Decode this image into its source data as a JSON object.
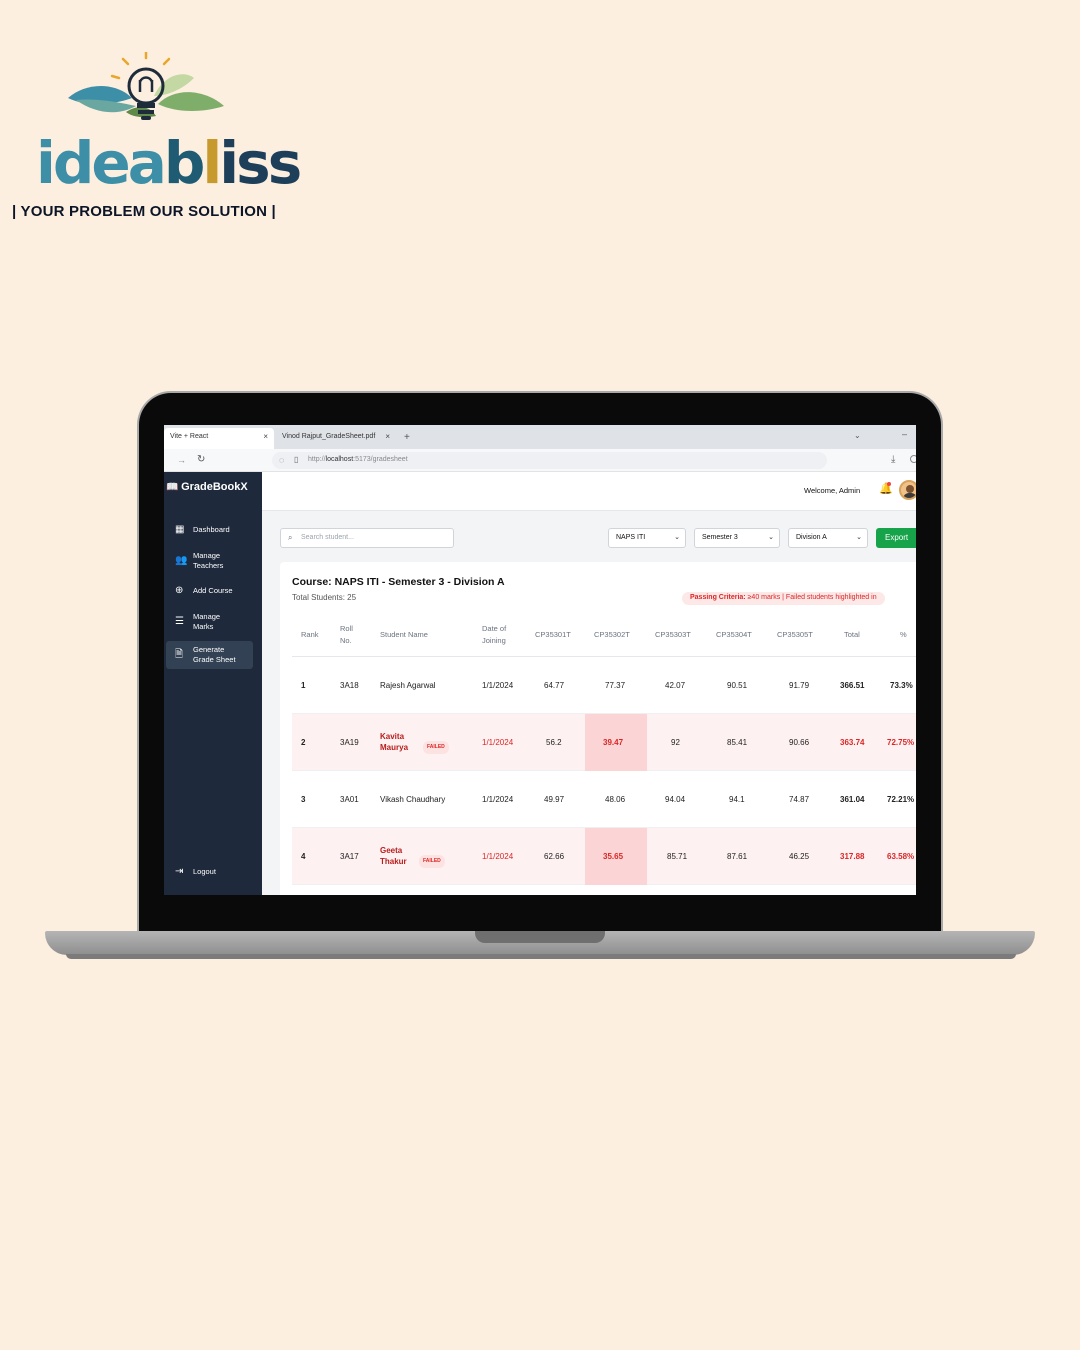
{
  "brand": {
    "logo_word_parts": [
      "idea",
      "b",
      "l",
      "iss"
    ],
    "tagline": "| YOUR PROBLEM OUR SOLUTION |"
  },
  "browser": {
    "tabs": [
      {
        "label": "Vite + React",
        "close": "×"
      },
      {
        "label": "Vinod Rajput_GradeSheet.pdf",
        "close": "×"
      }
    ],
    "new_tab": "+",
    "url_prefix": "http://",
    "url_host": "localhost",
    "url_path": ":5173/gradesheet"
  },
  "app": {
    "name": "GradeBookX",
    "welcome": "Welcome, Admin",
    "sidebar": [
      {
        "label": "Dashboard",
        "icon": "dashboard-icon"
      },
      {
        "label": "Manage Teachers",
        "icon": "users-icon"
      },
      {
        "label": "Add Course",
        "icon": "plus-circle-icon"
      },
      {
        "label": "Manage Marks",
        "icon": "list-icon"
      },
      {
        "label": "Generate Grade Sheet",
        "icon": "document-icon"
      }
    ],
    "logout": "Logout",
    "search": {
      "placeholder": "Search student..."
    },
    "filters": {
      "course": "NAPS ITI",
      "semester": "Semester 3",
      "division": "Division A"
    },
    "export_label": "Export",
    "course_title": "Course: NAPS ITI - Semester 3 - Division A",
    "total_students": "Total Students: 25",
    "criteria_label": "Passing Criteria:",
    "criteria_text": " ≥40 marks | Failed students highlighted in",
    "failed_badge": "FAILED",
    "columns": [
      "Rank",
      "Roll No.",
      "Student Name",
      "Date of Joining",
      "CP35301T",
      "CP35302T",
      "CP35303T",
      "CP35304T",
      "CP35305T",
      "Total",
      "%"
    ],
    "rows": [
      {
        "rank": "1",
        "roll": "3A18",
        "name": "Rajesh Agarwal",
        "doj": "1/1/2024",
        "s1": "64.77",
        "s2": "77.37",
        "s3": "42.07",
        "s4": "90.51",
        "s5": "91.79",
        "total": "366.51",
        "pct": "73.3%",
        "failed": false
      },
      {
        "rank": "2",
        "roll": "3A19",
        "name": "Kavita Maurya",
        "doj": "1/1/2024",
        "s1": "56.2",
        "s2": "39.47",
        "s3": "92",
        "s4": "85.41",
        "s5": "90.66",
        "total": "363.74",
        "pct": "72.75%",
        "failed": true
      },
      {
        "rank": "3",
        "roll": "3A01",
        "name": "Vikash Chaudhary",
        "doj": "1/1/2024",
        "s1": "49.97",
        "s2": "48.06",
        "s3": "94.04",
        "s4": "94.1",
        "s5": "74.87",
        "total": "361.04",
        "pct": "72.21%",
        "failed": false
      },
      {
        "rank": "4",
        "roll": "3A17",
        "name": "Geeta Thakur",
        "doj": "1/1/2024",
        "s1": "62.66",
        "s2": "35.65",
        "s3": "85.71",
        "s4": "87.61",
        "s5": "46.25",
        "total": "317.88",
        "pct": "63.58%",
        "failed": true
      }
    ]
  },
  "colors": {
    "page_bg": "#fdefe0",
    "sidebar_bg": "#1e293b",
    "export_green": "#16a34a",
    "fail_red": "#dc2626",
    "fail_row_bg": "#fdf1f1"
  }
}
